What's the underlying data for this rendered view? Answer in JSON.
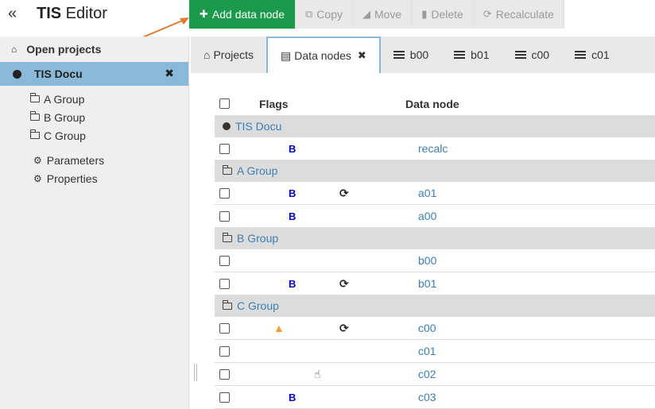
{
  "header": {
    "collapse_glyph": "«",
    "title_bold": "TIS",
    "title_rest": " Editor"
  },
  "toolbar": {
    "add_label": "Add data node",
    "copy_label": "Copy",
    "move_label": "Move",
    "delete_label": "Delete",
    "recalc_label": "Recalculate"
  },
  "sidebar": {
    "open_projects": "Open projects",
    "project": "TIS Docu",
    "groups": [
      "A Group",
      "B Group",
      "C Group"
    ],
    "parameters": "Parameters",
    "properties": "Properties"
  },
  "tabs": {
    "projects": "Projects",
    "data_nodes": "Data nodes",
    "b00": "b00",
    "b01": "b01",
    "c00": "c00",
    "c01": "c01"
  },
  "table": {
    "col_flags": "Flags",
    "col_node": "Data node",
    "rows": [
      {
        "type": "group",
        "label": "TIS Docu"
      },
      {
        "type": "node",
        "name": "recalc",
        "b": "B"
      },
      {
        "type": "group",
        "label": "A Group"
      },
      {
        "type": "node",
        "name": "a01",
        "b": "B",
        "recalc": true
      },
      {
        "type": "node",
        "name": "a00",
        "b": "B"
      },
      {
        "type": "group",
        "label": "B Group"
      },
      {
        "type": "node",
        "name": "b00"
      },
      {
        "type": "node",
        "name": "b01",
        "b": "B",
        "recalc": true
      },
      {
        "type": "group",
        "label": "C Group"
      },
      {
        "type": "node",
        "name": "c00",
        "warn": true,
        "recalc": true
      },
      {
        "type": "node",
        "name": "c01"
      },
      {
        "type": "node",
        "name": "c02",
        "hand": true
      },
      {
        "type": "node",
        "name": "c03",
        "b": "B"
      }
    ]
  },
  "colors": {
    "primary_button": "#1a9a4a",
    "selected_project": "#8ab8d8",
    "link": "#3a7fb5",
    "arrow": "#e07a30"
  }
}
